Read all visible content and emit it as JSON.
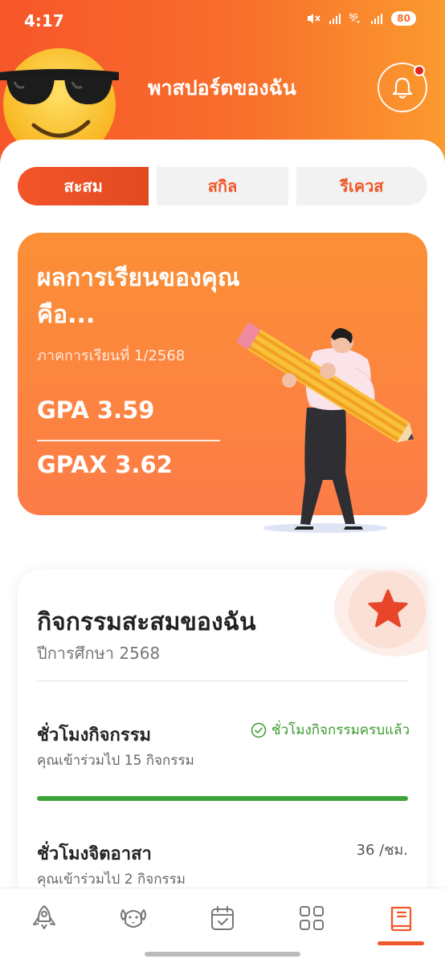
{
  "status_bar": {
    "time": "4:17",
    "battery": "80"
  },
  "header": {
    "title": "พาสปอร์ตของฉัน",
    "avatar_icon": "sunglasses-emoji",
    "bell_icon": "bell-icon",
    "has_notification": true
  },
  "tabs": [
    {
      "label": "สะสม",
      "active": true
    },
    {
      "label": "สกิล",
      "active": false
    },
    {
      "label": "รีเควส",
      "active": false
    }
  ],
  "gpa_card": {
    "title": "ผลการเรียนของคุณคือ...",
    "semester": "ภาคการเรียนที่ 1/2568",
    "gpa": "GPA 3.59",
    "gpax": "GPAX 3.62"
  },
  "activity_card": {
    "title": "กิจกรรมสะสมของฉัน",
    "academic_year": "ปีการศึกษา 2568",
    "activity_hours": {
      "title": "ชั่วโมงกิจกรรม",
      "subtitle": "คุณเข้าร่วมไป 15 กิจกรรม",
      "status": "ชั่วโมงกิจกรรมครบแล้ว",
      "progress": 1.0
    },
    "volunteer_hours": {
      "title": "ชั่วโมงจิตอาสา",
      "subtitle": "คุณเข้าร่วมไป 2 กิจกรรม",
      "hours": "36 /ชม."
    }
  },
  "bottom_nav": [
    {
      "icon": "rocket-icon",
      "active": false
    },
    {
      "icon": "dog-icon",
      "active": false
    },
    {
      "icon": "calendar-check-icon",
      "active": false
    },
    {
      "icon": "grid-icon",
      "active": false
    },
    {
      "icon": "passport-book-icon",
      "active": true
    }
  ],
  "colors": {
    "brand_orange": "#f0582a",
    "success_green": "#3aa33a",
    "notification_red": "#e0261d"
  }
}
